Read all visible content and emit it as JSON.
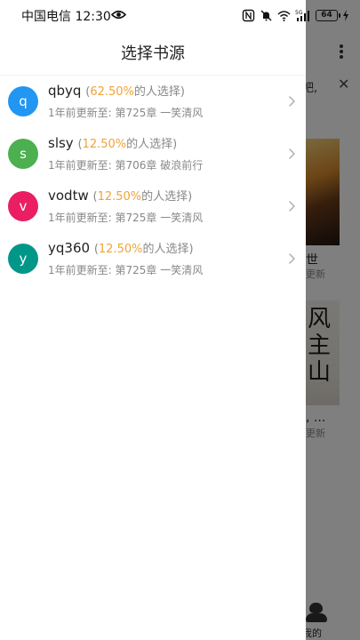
{
  "status_bar": {
    "carrier_time": "中国电信 12:30",
    "battery": "64",
    "network": "5G"
  },
  "drawer": {
    "title": "选择书源",
    "sources": [
      {
        "avatar_letter": "q",
        "avatar_color": "#2196f3",
        "name": "qbyq",
        "percent": "62.50%",
        "choose_suffix": "的人选择)",
        "update_prefix": "1年前更新至:",
        "latest_chapter": "第725章 一笑清风"
      },
      {
        "avatar_letter": "s",
        "avatar_color": "#4caf50",
        "name": "slsy",
        "percent": "12.50%",
        "choose_suffix": "的人选择)",
        "update_prefix": "1年前更新至:",
        "latest_chapter": "第706章 破浪前行"
      },
      {
        "avatar_letter": "v",
        "avatar_color": "#e91e63",
        "name": "vodtw",
        "percent": "12.50%",
        "choose_suffix": "的人选择)",
        "update_prefix": "1年前更新至:",
        "latest_chapter": "第725章 一笑清风"
      },
      {
        "avatar_letter": "y",
        "avatar_color": "#009688",
        "name": "yq360",
        "percent": "12.50%",
        "choose_suffix": "的人选择)",
        "update_prefix": "1年前更新至:",
        "latest_chapter": "第725章 一笑清风"
      }
    ]
  },
  "background": {
    "banner_text": "吧,",
    "book1_title": "世",
    "book1_sub": "更新",
    "book2_cover_text": "风\n主\n山",
    "book2_title": ", ...",
    "book2_sub": "更新",
    "nav_label": "我的"
  }
}
